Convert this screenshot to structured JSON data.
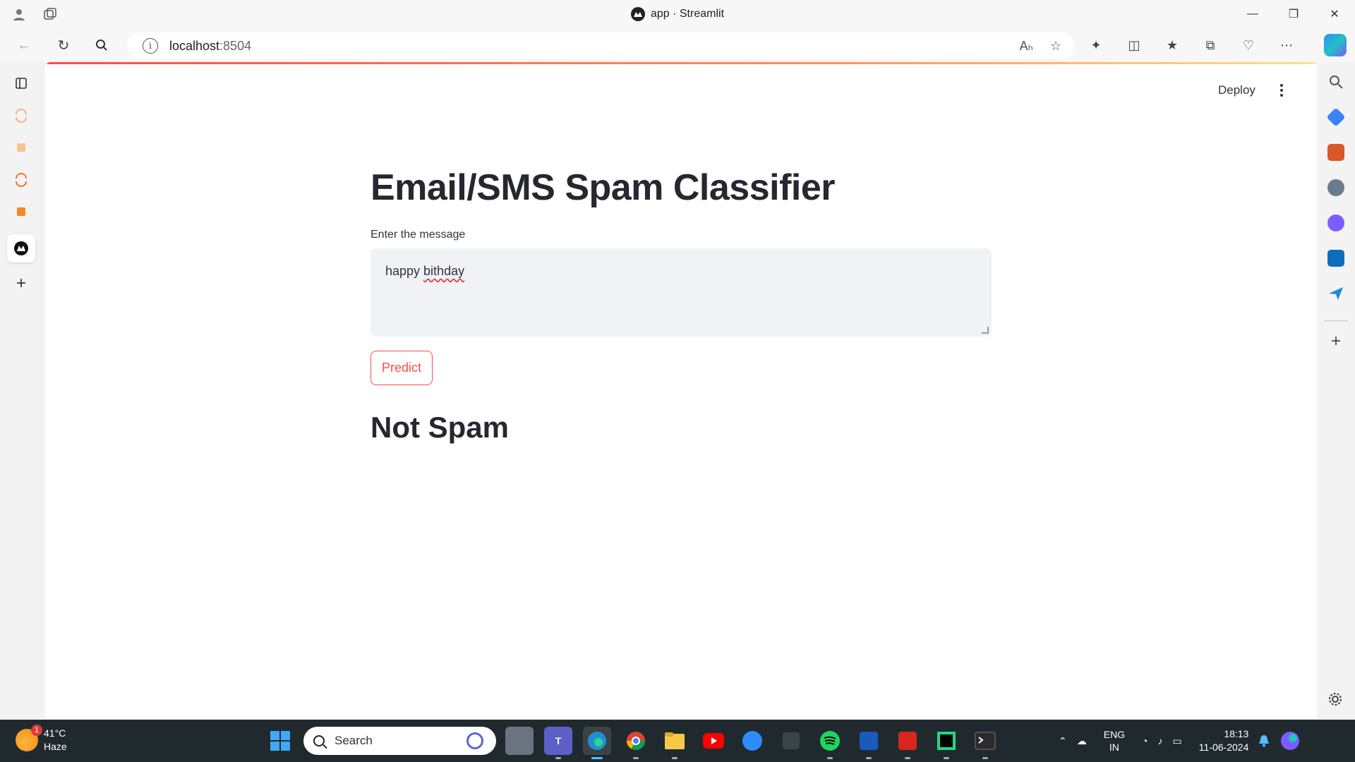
{
  "window": {
    "title": "app · Streamlit",
    "controls": [
      "minimize",
      "restore",
      "close"
    ]
  },
  "browser": {
    "url_host": "localhost",
    "url_port": ":8504"
  },
  "app": {
    "deploy_label": "Deploy",
    "title": "Email/SMS Spam Classifier",
    "input_label": "Enter the message",
    "input_value_part1": "happy ",
    "input_value_part2": "bithday",
    "predict_label": "Predict",
    "result": "Not Spam"
  },
  "taskbar": {
    "weather_badge": "1",
    "temperature": "41°C",
    "condition": "Haze",
    "search_placeholder": "Search",
    "lang_line1": "ENG",
    "lang_line2": "IN",
    "time": "18:13",
    "date": "11-06-2024"
  },
  "colors": {
    "accent": "#ff4b4b",
    "text": "#262730",
    "input_bg": "#f0f2f6",
    "taskbar": "#202a2e"
  }
}
